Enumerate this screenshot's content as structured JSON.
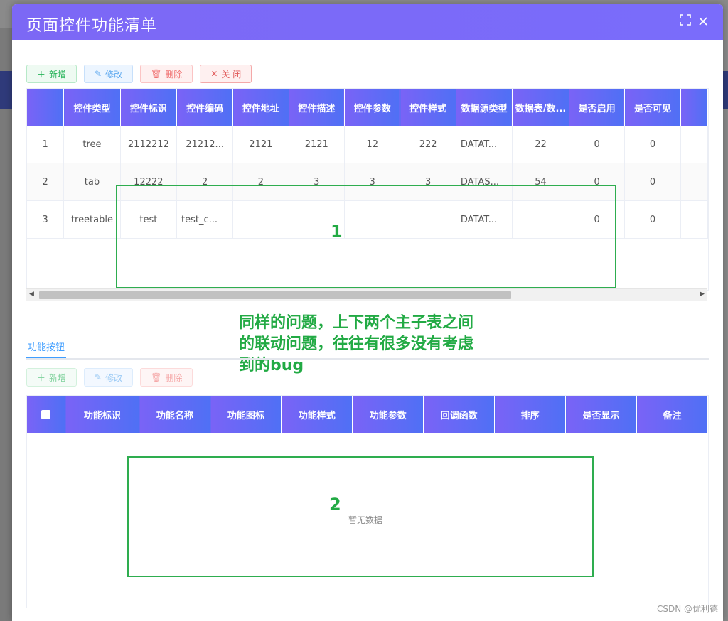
{
  "modal": {
    "title": "页面控件功能清单",
    "maximize_icon": "maximize-icon",
    "close_icon": "close-icon"
  },
  "toolbar_top": {
    "add_label": "新增",
    "edit_label": "修改",
    "delete_label": "删除",
    "close_label": "关 闭"
  },
  "main_table": {
    "headers": [
      "",
      "控件类型",
      "控件标识",
      "控件编码",
      "控件地址",
      "控件描述",
      "控件参数",
      "控件样式",
      "数据源类型",
      "数据表/数...",
      "是否启用",
      "是否可见"
    ],
    "rows": [
      [
        "1",
        "tree",
        "2112212",
        "21212...",
        "2121",
        "2121",
        "12",
        "222",
        "DATAT...",
        "22",
        "0",
        "0"
      ],
      [
        "2",
        "tab",
        "12222",
        "2",
        "2",
        "3",
        "3",
        "3",
        "DATAS...",
        "54",
        "0",
        "0"
      ],
      [
        "3",
        "treetable",
        "test",
        "test_c...",
        "",
        "",
        "",
        "",
        "DATAT...",
        "",
        "0",
        "0"
      ]
    ]
  },
  "annotations": {
    "box1_label": "1",
    "box2_label": "2",
    "text_line1": "同样的问题，上下两个主子表之间",
    "text_line2": "的联动问题，往往有很多没有考虑",
    "text_line3": "到的bug"
  },
  "tabs": {
    "active": "功能按钮"
  },
  "toolbar_bottom": {
    "add_label": "新增",
    "edit_label": "修改",
    "delete_label": "删除"
  },
  "sub_table": {
    "headers": [
      "功能标识",
      "功能名称",
      "功能图标",
      "功能样式",
      "功能参数",
      "回调函数",
      "排序",
      "是否显示",
      "备注"
    ],
    "empty_text": "暂无数据"
  },
  "watermark": "CSDN @优利德",
  "colors": {
    "header_gradient_start": "#7a63f6",
    "header_gradient_end": "#4f70f5",
    "annotation_green": "#22aa44",
    "modal_header": "#7a6cfb"
  }
}
